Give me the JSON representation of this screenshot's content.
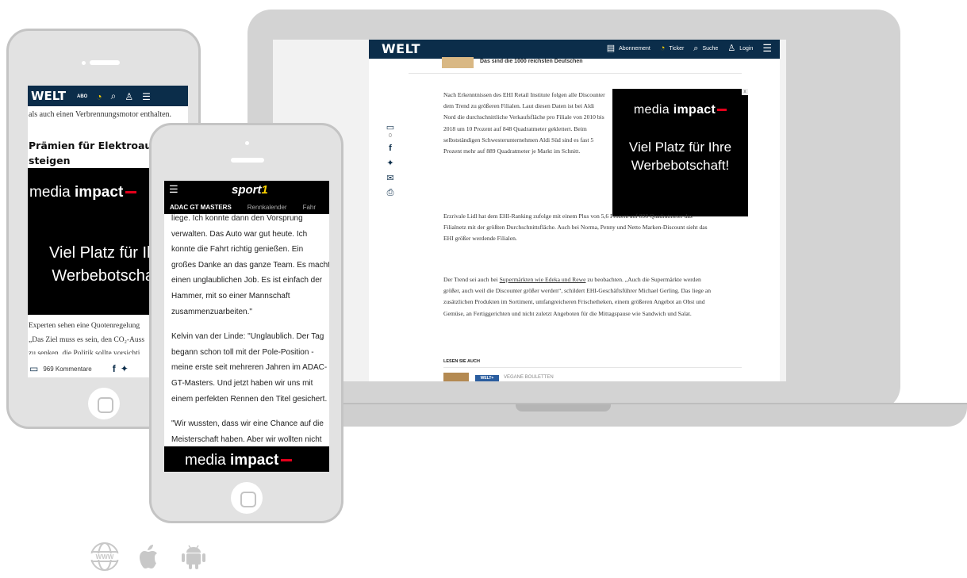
{
  "laptop": {
    "welt": {
      "logo": "WELT",
      "nav": [
        {
          "icon": "newspaper-icon",
          "label": "Abonnement"
        },
        {
          "icon": "ticker-icon",
          "label": "Ticker"
        },
        {
          "icon": "search-icon",
          "label": "Suche"
        },
        {
          "icon": "user-icon",
          "label": "Login"
        }
      ],
      "teaser": "Das sind die 1000 reichsten Deutschen",
      "share_count": "0",
      "article": {
        "p1": "Nach Erkenntnissen des EHI Retail Institute folgen alle Discounter dem Trend zu größeren Filialen. Laut diesen Daten ist bei Aldi Nord die durchschnittliche Verkaufsfläche pro Filiale von 2010 bis 2018 um 10 Prozent auf 848 Quadratmeter geklettert. Beim selbstständigen Schwesterunternehmen Aldi Süd sind es fast 5 Prozent mehr auf 889 Quadratmeter je Markt im Schnitt.",
        "p2": "Erzrivale Lidl hat dem EHI-Ranking zufolge mit einem Plus von 5,6 Prozent auf 898 Quadratmeter das Filialnetz mit der größten Durchschnittsfläche. Auch bei Norma, Penny und Netto Marken-Discount sieht das EHI größer werdende Filialen.",
        "p3_before": "Der Trend sei auch bei ",
        "p3_link": "Supermärkten wie Edeka und Rewe",
        "p3_after": " zu beobachten. „Auch die Supermärkte werden größer, auch weil die Discounter größer werden“, schildert EHI-Geschäftsführer Michael Gerling. Das liege an zusätzlichen Produkten im Sortiment, umfangreicheren Frischetheken, einem größeren Angebot an Obst und Gemüse, an Fertiggerichten und nicht zuletzt Angeboten für die Mittagspause wie Sandwich und Salat."
      },
      "ad": {
        "brand_light": "media ",
        "brand_bold": "impact",
        "message": "Viel Platz für Ihre Werbebotschaft!",
        "close": "x"
      },
      "lesen_sie_auch": "LESEN SIE AUCH",
      "lesen_badge": "WELT+",
      "lesen_title": "VEGANE BOULETTEN"
    }
  },
  "phone_back": {
    "logo": "WELT",
    "abo": "ABO",
    "text_top": "als auch einen Verbrennungsmotor enthalten.",
    "headline": "Prämien für Elektroautos steigen",
    "ad": {
      "brand_light": "media ",
      "brand_bold": "impact",
      "message": "Viel Platz für Ihre Werbebotschaft!"
    },
    "p1": "Experten sehen eine Quotenregelung",
    "p2": "„Das Ziel muss es sein, den CO₂-Auss",
    "p3": "zu senken, die Politik sollte vorsichti",
    "comments": "969 Kommentare"
  },
  "phone_front": {
    "logo_text": "sport",
    "logo_num": "1",
    "tabs": [
      "ADAC GT MASTERS",
      "Rennkalender",
      "Fahr"
    ],
    "paragraphs": [
      "liege. Ich konnte dann den Vorsprung verwalten. Das Auto war gut heute. Ich konnte die Fahrt richtig genießen. Ein großes Danke an das ganze Team. Es macht einen unglaublichen Job. Es ist einfach der Hammer, mit so einer Mannschaft zusammenzuarbeiten.\"",
      "Kelvin van der Linde: \"Unglaublich. Der Tag begann schon toll mit der Pole-Position - meine erste seit mehreren Jahren im ADAC-GT-Masters. Und jetzt haben wir uns mit einem perfekten Rennen den Titel gesichert.",
      "\"Wir wussten, dass wir eine Chance auf die Meisterschaft haben. Aber wir wollten nicht zu viel darüber nachdenken. Wir haben versucht, unser eigenes Rennen zu fahren."
    ],
    "ad": {
      "brand_light": "media ",
      "brand_bold": "impact"
    }
  },
  "platforms": [
    "www-globe-icon",
    "apple-icon",
    "android-icon"
  ],
  "colors": {
    "welt_navy": "#0b2d4a",
    "ad_red": "#e3001b",
    "sport1_yellow": "#ffd400",
    "device_gray": "#d3d3d3"
  }
}
